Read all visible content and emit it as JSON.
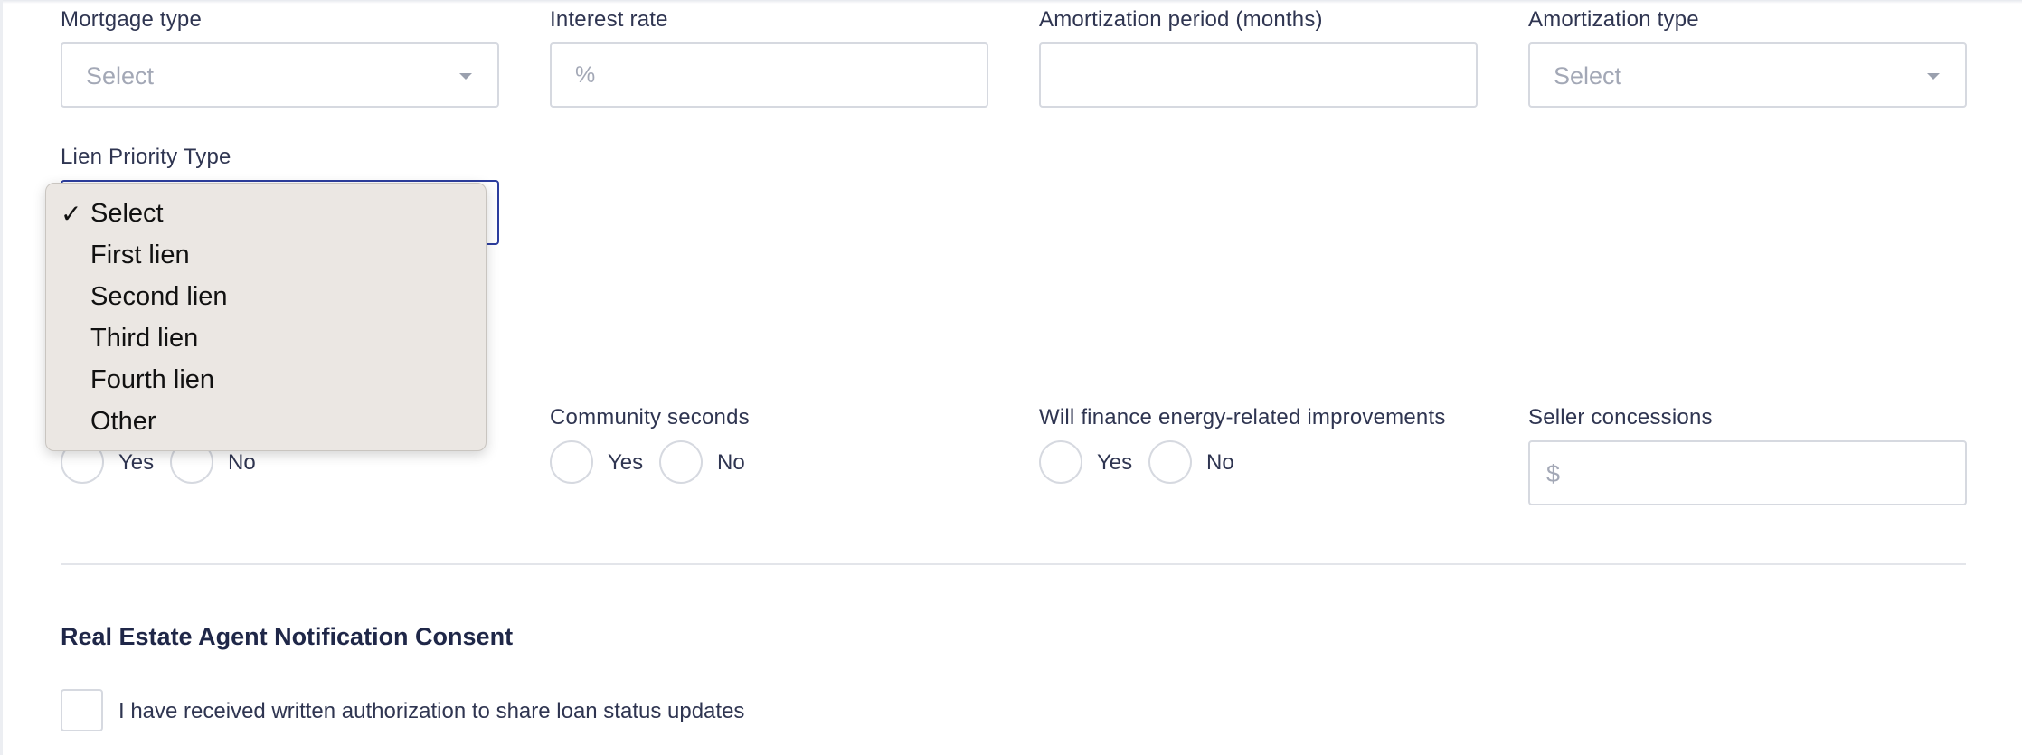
{
  "fields": {
    "mortgage_type": {
      "label": "Mortgage type",
      "placeholder": "Select"
    },
    "interest_rate": {
      "label": "Interest rate",
      "placeholder": "%"
    },
    "amortization_period": {
      "label": "Amortization period (months)",
      "placeholder": ""
    },
    "amortization_type": {
      "label": "Amortization type",
      "placeholder": "Select"
    },
    "lien_priority": {
      "label": "Lien Priority Type",
      "selected": "Select"
    }
  },
  "lien_dropdown": {
    "check_icon": "✓",
    "options": [
      "Select",
      "First lien",
      "Second lien",
      "Third lien",
      "Fourth lien",
      "Other"
    ]
  },
  "radios": {
    "first_group": {
      "yes": "Yes",
      "no": "No"
    },
    "community_seconds": {
      "label": "Community seconds",
      "yes": "Yes",
      "no": "No"
    },
    "energy_improvements": {
      "label": "Will finance energy-related improvements",
      "yes": "Yes",
      "no": "No"
    }
  },
  "seller_concessions": {
    "label": "Seller concessions",
    "placeholder": "$"
  },
  "consent": {
    "title": "Real Estate Agent Notification Consent",
    "checkbox_label": "I have received written authorization to share loan status updates"
  },
  "colors": {
    "focus_border": "#2d3e9e",
    "input_border": "#d6d9e0",
    "dropdown_bg": "#ebe7e3"
  }
}
